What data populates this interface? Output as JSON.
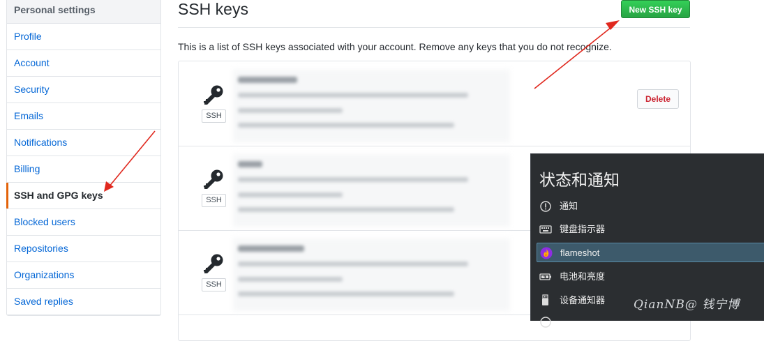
{
  "sidebar": {
    "header": "Personal settings",
    "items": [
      {
        "label": "Profile"
      },
      {
        "label": "Account"
      },
      {
        "label": "Security"
      },
      {
        "label": "Emails"
      },
      {
        "label": "Notifications"
      },
      {
        "label": "Billing"
      },
      {
        "label": "SSH and GPG keys",
        "selected": true
      },
      {
        "label": "Blocked users"
      },
      {
        "label": "Repositories"
      },
      {
        "label": "Organizations"
      },
      {
        "label": "Saved replies"
      }
    ]
  },
  "main": {
    "title": "SSH keys",
    "new_key_button": "New SSH key",
    "intro": "This is a list of SSH keys associated with your account. Remove any keys that you do not recognize.",
    "keys": [
      {
        "badge": "SSH",
        "action": "Delete"
      },
      {
        "badge": "SSH"
      },
      {
        "badge": "SSH"
      }
    ]
  },
  "tray": {
    "title": "状态和通知",
    "items": [
      {
        "label": "通知",
        "icon": "alert-circle-icon"
      },
      {
        "label": "键盘指示器",
        "icon": "keyboard-icon"
      },
      {
        "label": "flameshot",
        "icon": "flameshot-icon",
        "highlighted": true
      },
      {
        "label": "电池和亮度",
        "icon": "battery-icon"
      },
      {
        "label": "设备通知器",
        "icon": "usb-drive-icon"
      }
    ]
  },
  "watermark": "QianNB@ 钱宁博",
  "colors": {
    "link": "#0366d6",
    "primary_button": "#2ea44f",
    "danger": "#cb2431",
    "selected_marker": "#e36209",
    "annotation_arrow": "#e0281e",
    "tray_background": "#2b2e31"
  }
}
